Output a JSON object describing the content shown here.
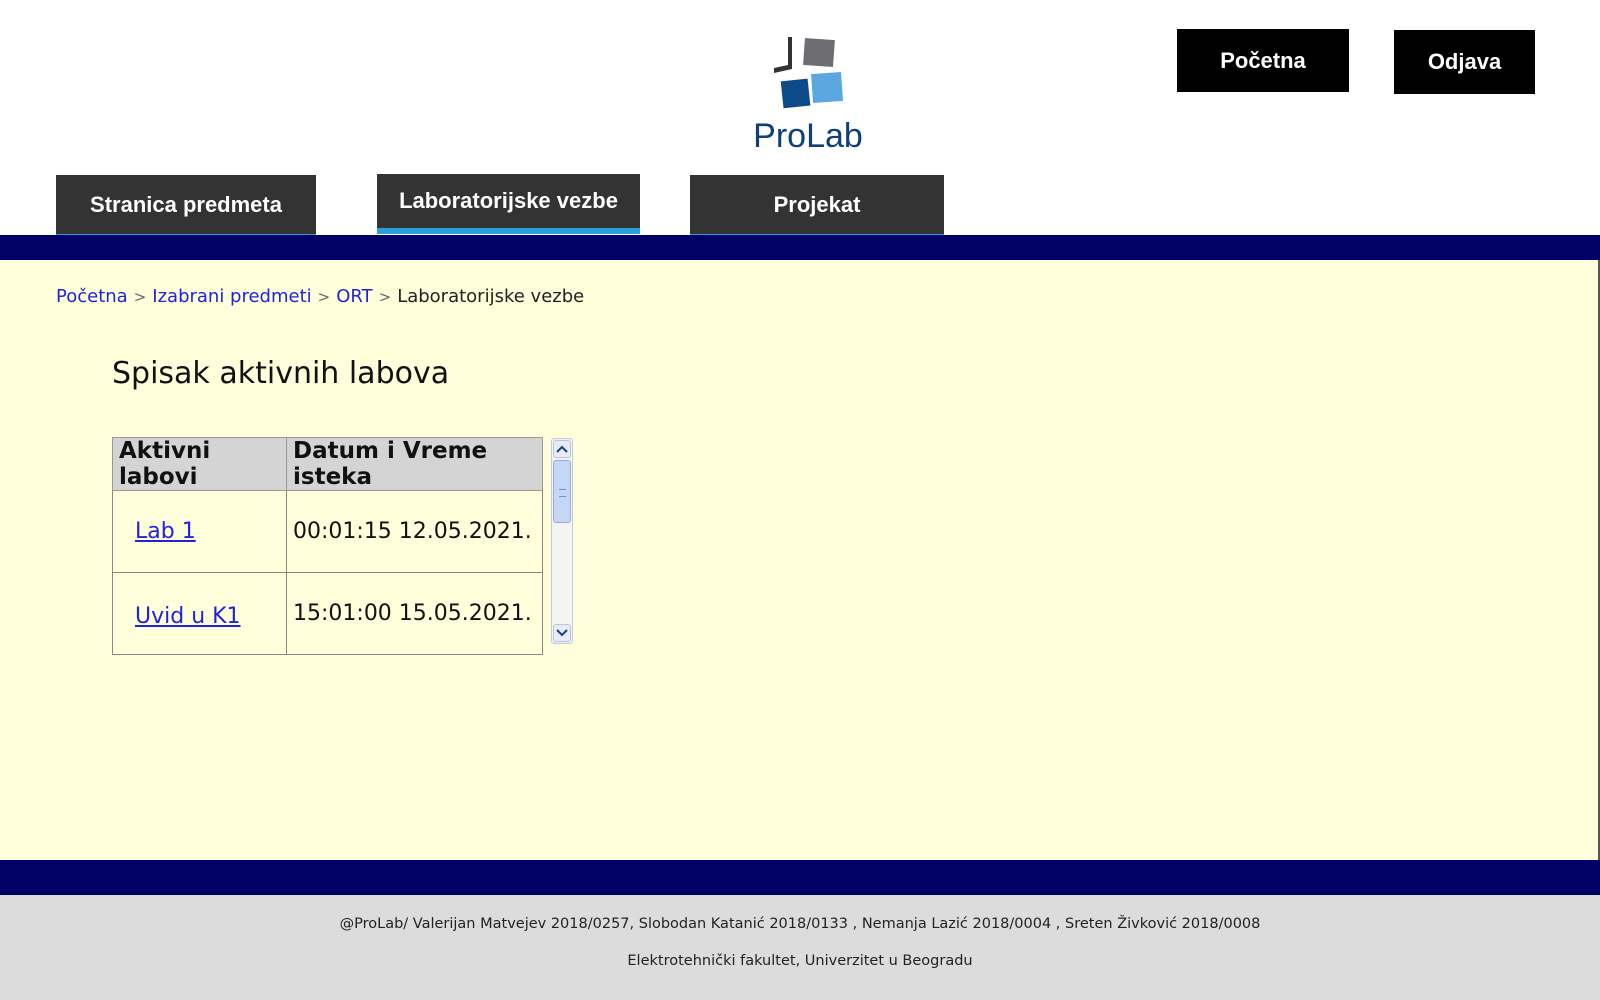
{
  "header": {
    "logo_text": "ProLab",
    "home_button": "Početna",
    "logout_button": "Odjava"
  },
  "tabs": [
    {
      "label": "Stranica predmeta",
      "active": false
    },
    {
      "label": "Laboratorijske vezbe",
      "active": true
    },
    {
      "label": "Projekat",
      "active": false
    }
  ],
  "colors": {
    "nav_bar": "#000066",
    "content_bg": "#ffffdc",
    "tab_bg": "#333333",
    "tab_active_underline": "#2a9fd8",
    "link": "#2222dd",
    "footer_bg": "#dcdcdc"
  },
  "breadcrumb": {
    "items": [
      "Početna",
      "Izabrani predmeti",
      "ORT"
    ],
    "separator": ">",
    "current": "Laboratorijske vezbe"
  },
  "main": {
    "title": "Spisak aktivnih labova",
    "table": {
      "headers": [
        "Aktivni labovi",
        "Datum i Vreme isteka"
      ],
      "rows": [
        {
          "lab": "Lab 1",
          "deadline": "00:01:15 12.05.2021."
        },
        {
          "lab": "Uvid u K1",
          "deadline": "15:01:00 15.05.2021."
        }
      ]
    },
    "scrollbar": {
      "up_icon": "chevron-up-icon",
      "down_icon": "chevron-down-icon"
    }
  },
  "footer": {
    "credits": "@ProLab/ Valerijan Matvejev 2018/0257, Slobodan Katanić 2018/0133 , Nemanja Lazić 2018/0004 , Sreten Živković 2018/0008",
    "institution": "Elektrotehnički fakultet, Univerzitet u Beogradu"
  }
}
